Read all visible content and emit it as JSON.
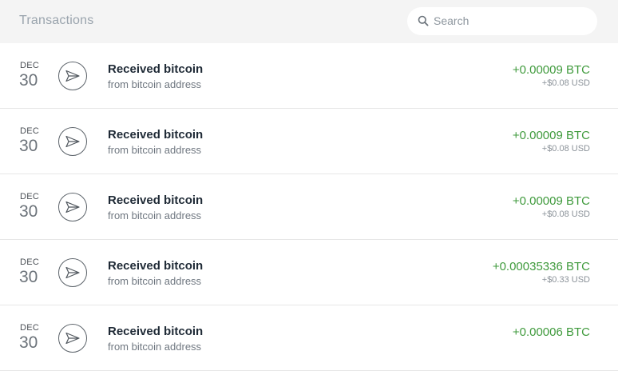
{
  "header": {
    "title": "Transactions",
    "search_placeholder": "Search",
    "search_icon": "search-icon"
  },
  "transactions": [
    {
      "month": "DEC",
      "day": "30",
      "icon": "send-icon",
      "title": "Received bitcoin",
      "subtitle": "from bitcoin address",
      "amount_btc": "+0.00009 BTC",
      "amount_usd": "+$0.08 USD"
    },
    {
      "month": "DEC",
      "day": "30",
      "icon": "send-icon",
      "title": "Received bitcoin",
      "subtitle": "from bitcoin address",
      "amount_btc": "+0.00009 BTC",
      "amount_usd": "+$0.08 USD"
    },
    {
      "month": "DEC",
      "day": "30",
      "icon": "send-icon",
      "title": "Received bitcoin",
      "subtitle": "from bitcoin address",
      "amount_btc": "+0.00009 BTC",
      "amount_usd": "+$0.08 USD"
    },
    {
      "month": "DEC",
      "day": "30",
      "icon": "send-icon",
      "title": "Received bitcoin",
      "subtitle": "from bitcoin address",
      "amount_btc": "+0.00035336 BTC",
      "amount_usd": "+$0.33 USD"
    },
    {
      "month": "DEC",
      "day": "30",
      "icon": "send-icon",
      "title": "Received bitcoin",
      "subtitle": "from bitcoin address",
      "amount_btc": "+0.00006 BTC",
      "amount_usd": ""
    }
  ],
  "colors": {
    "header_bg": "#f4f4f4",
    "amount_positive": "#3f9a3c",
    "divider": "#e6e6e6"
  }
}
